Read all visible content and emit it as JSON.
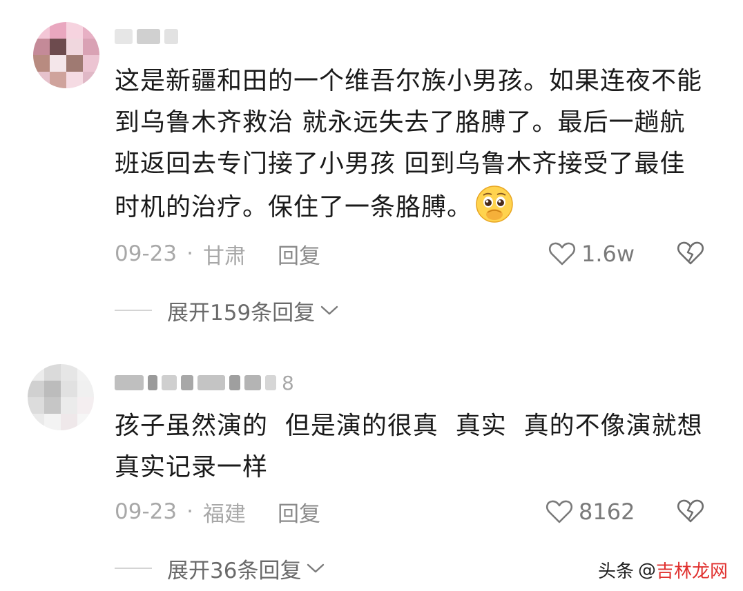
{
  "comments": [
    {
      "text": "这是新疆和田的一个维吾尔族小男孩。如果连夜不能到乌鲁木齐救治 就永远失去了胳膊了。最后一趟航班返回去专门接了小男孩 回到乌鲁木齐接受了最佳时机的治疗。保住了一条胳膊。",
      "date": "09-23",
      "location": "甘肃",
      "reply_label": "回复",
      "likes": "1.6w",
      "expand_label": "展开159条回复"
    },
    {
      "username_suffix": "8",
      "text": "孩子虽然演的  但是演的很真  真实  真的不像演就想真实记录一样",
      "date": "09-23",
      "location": "福建",
      "reply_label": "回复",
      "likes": "8162",
      "expand_label": "展开36条回复"
    }
  ],
  "meta_separator": "·",
  "watermark": {
    "prefix": "头条",
    "at": "@",
    "brand": "吉林龙网"
  },
  "icons": {
    "like": "heart-outline-icon",
    "dislike": "broken-heart-icon",
    "expand": "chevron-down-icon",
    "emoji": "pleading-face-emoji"
  }
}
